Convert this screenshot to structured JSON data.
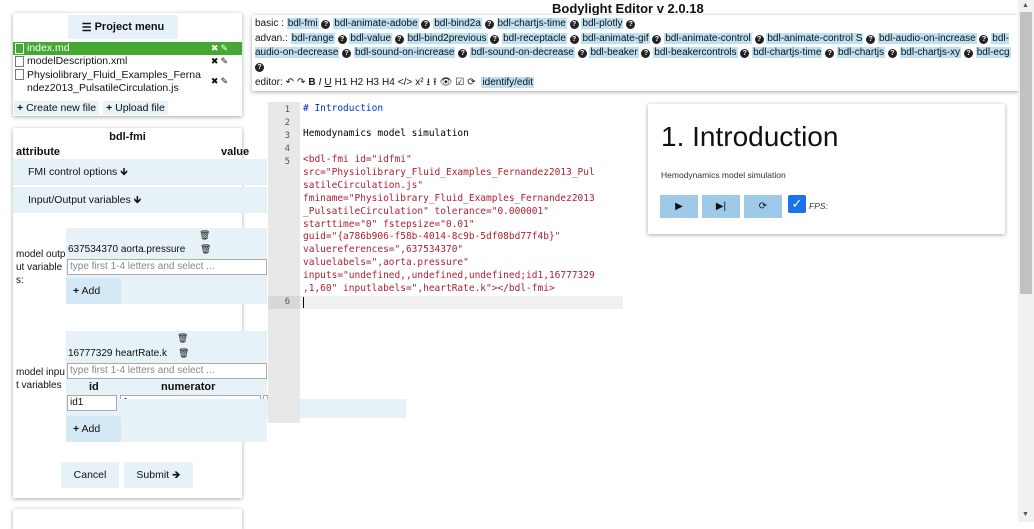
{
  "app": {
    "title": "Bodylight Editor v 2.0.18"
  },
  "project_menu": {
    "label": "Project menu",
    "files": [
      {
        "name": "index.md"
      },
      {
        "name": "modelDescription.xml"
      },
      {
        "name": "Physiolibrary_Fluid_Examples_Fernandez2013_PulsatileCirculation.js"
      }
    ],
    "create_label": "Create new file",
    "upload_label": "Upload file"
  },
  "form": {
    "title": "bdl-fmi",
    "col_attribute": "attribute",
    "col_value": "value",
    "fmi_control_label": "FMI control options",
    "io_label": "Input/Output variables",
    "output_label": "model output variables:",
    "output_value": "637534370 aorta.pressure",
    "output_placeholder": "type first 1-4 letters and select ...",
    "add_label": "Add",
    "input_label": "model input variables",
    "input_value": "16777329 heartRate.k",
    "input_placeholder": "type first 1-4 letters and select ...",
    "col_id": "id",
    "col_numerator": "numerator",
    "id_value": "id1",
    "numerator_value": "1",
    "cancel_label": "Cancel",
    "submit_label": "Submit"
  },
  "toolbar": {
    "basic_label": "basic :",
    "basic_items": [
      "bdl-fmi",
      "bdl-animate-adobe",
      "bdl-bind2a",
      "bdl-chartjs-time",
      "bdl-plotly"
    ],
    "advan_label": "advan.:",
    "advan_items": [
      "bdl-range",
      "bdl-value",
      "bdl-bind2previous",
      "bdl-receptacle",
      "bdl-animate-gif",
      "bdl-animate-control",
      "bdl-animate-control S",
      "bdl-audio-on-increase",
      "bdl-audio-on-decrease",
      "bdl-sound-on-increase",
      "bdl-sound-on-decrease",
      "bdl-beaker",
      "bdl-beakercontrols",
      "bdl-chartjs-time",
      "bdl-chartjs",
      "bdl-chartjs-xy",
      "bdl-ecg"
    ],
    "editor_label": "editor:",
    "editor_tools": [
      "↶",
      "↷",
      "B",
      "I",
      "U",
      "H1",
      "H2",
      "H3",
      "H4",
      "</>",
      "x²",
      "⭳",
      "⭱",
      "👁",
      "☑",
      "⟳"
    ],
    "identify_label": "identify/edit"
  },
  "editor": {
    "line_numbers": [
      "1",
      "2",
      "3",
      "4",
      "5",
      "6"
    ],
    "line1": "# Introduction",
    "line3": "Hemodynamics model simulation",
    "line5a": "<bdl-fmi id=\"idfmi\"",
    "line5b": "src=\"Physiolibrary_Fluid_Examples_Fernandez2013_Pul",
    "line5c": "satileCirculation.js\"",
    "line5d": "fminame=\"Physiolibrary_Fluid_Examples_Fernandez2013",
    "line5e": "_PulsatileCirculation\" tolerance=\"0.000001\"",
    "line5f": "starttime=\"0\" fstepsize=\"0.01\"",
    "line5g": "guid=\"{a786b906-f58b-4014-8c9b-5df08bd77f4b}\"",
    "line5h": "valuereferences=\",637534370\"",
    "line5i": "valuelabels=\",aorta.pressure\"",
    "line5j": "inputs=\"undefined,,undefined,undefined;id1,16777329",
    "line5k": ",1,60\" inputlabels=\",heartRate.k\"></bdl-fmi>"
  },
  "preview": {
    "heading": "1. Introduction",
    "subtitle": "Hemodynamics model simulation",
    "play": "▶",
    "step": "▶|",
    "reload": "⟳",
    "fps_label": "FPS:"
  }
}
